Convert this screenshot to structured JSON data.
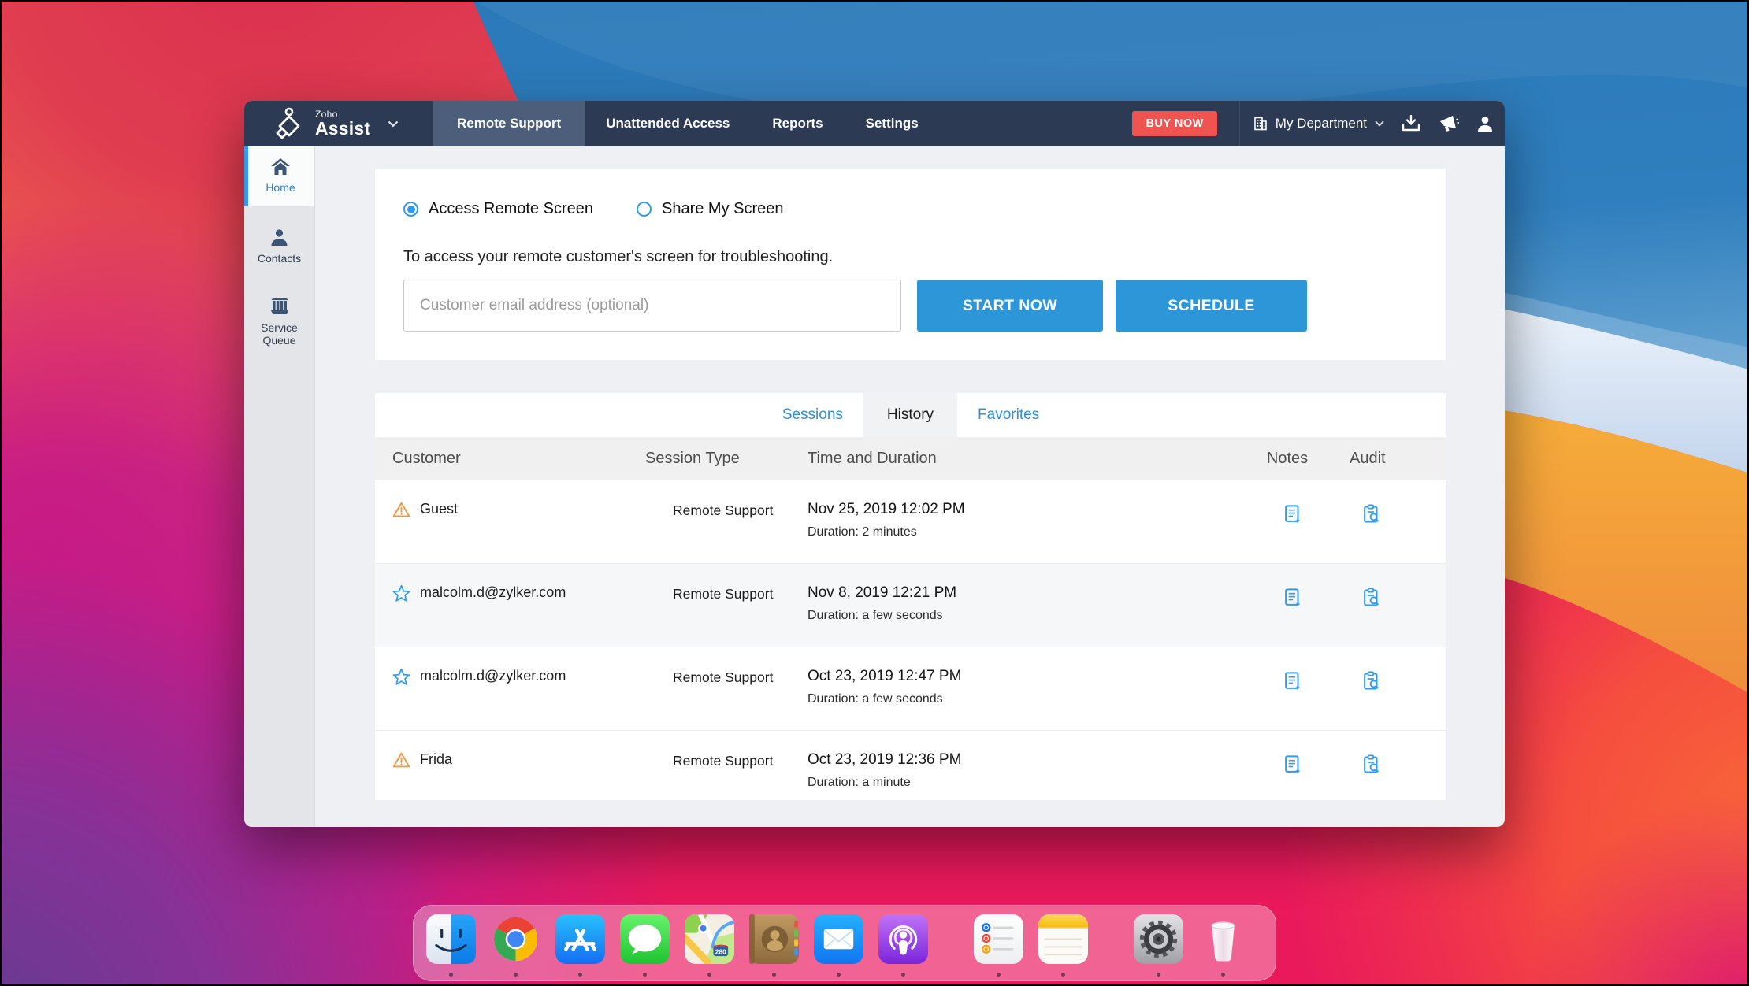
{
  "window": {
    "logo": {
      "zoho": "Zoho",
      "assist": "Assist"
    },
    "nav": {
      "items": [
        "Remote Support",
        "Unattended Access",
        "Reports",
        "Settings"
      ],
      "active": "Remote Support"
    },
    "topbar": {
      "buy_now": "BUY NOW",
      "department": "My Department"
    },
    "sidebar": {
      "items": [
        {
          "label": "Home",
          "icon": "home-icon"
        },
        {
          "label": "Contacts",
          "icon": "contacts-icon"
        },
        {
          "label": "Service Queue",
          "icon": "service-queue-icon"
        }
      ],
      "active": "Home"
    },
    "session_panel": {
      "radio_access": "Access Remote Screen",
      "radio_share": "Share My Screen",
      "selected_radio": "Access Remote Screen",
      "description": "To access your remote customer's screen for troubleshooting.",
      "email_placeholder": "Customer email address (optional)",
      "start_button": "START NOW",
      "schedule_button": "SCHEDULE"
    },
    "history_panel": {
      "tabs": [
        "Sessions",
        "History",
        "Favorites"
      ],
      "active_tab": "History",
      "columns": [
        "Customer",
        "Session Type",
        "Time and Duration",
        "Notes",
        "Audit"
      ],
      "rows": [
        {
          "icon": "warning",
          "customer": "Guest",
          "session_type": "Remote Support",
          "time": "Nov 25, 2019 12:02 PM",
          "duration": "Duration: 2 minutes"
        },
        {
          "icon": "star",
          "customer": "malcolm.d@zylker.com",
          "session_type": "Remote Support",
          "time": "Nov 8, 2019 12:21 PM",
          "duration": "Duration: a few seconds"
        },
        {
          "icon": "star",
          "customer": "malcolm.d@zylker.com",
          "session_type": "Remote Support",
          "time": "Oct 23, 2019 12:47 PM",
          "duration": "Duration: a few seconds"
        },
        {
          "icon": "warning",
          "customer": "Frida",
          "session_type": "Remote Support",
          "time": "Oct 23, 2019 12:36 PM",
          "duration": "Duration: a minute"
        }
      ]
    }
  },
  "dock": {
    "apps": [
      "Finder",
      "Chrome",
      "App Store",
      "Messages",
      "Maps",
      "Contacts",
      "Mail",
      "Podcasts",
      "Reminders",
      "Notes",
      "System Preferences",
      "Trash"
    ]
  },
  "colors": {
    "navbar": "#2d3a53",
    "accent_blue": "#2c96d9",
    "link_blue": "#2e90dd",
    "buy_now_red": "#f05450",
    "warning_orange": "#f0993f"
  }
}
